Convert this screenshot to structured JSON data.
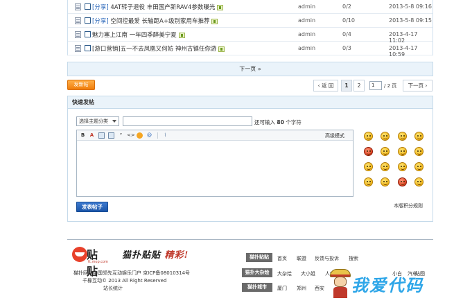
{
  "threads": [
    {
      "tag": "[分享]",
      "title": "4AT转子退役 丰田国产新RAV4参数曝光",
      "author": "admin",
      "replies": "0/2",
      "date": "2013-5-8 09:16"
    },
    {
      "tag": "[分享]",
      "title": "空间控最爱 长轴距A+级别家用车推荐",
      "author": "admin",
      "replies": "0/10",
      "date": "2013-5-8 09:15"
    },
    {
      "tag": "",
      "title": "魅力塞上江南 一年四季醉美宁夏",
      "author": "admin",
      "replies": "0/4",
      "date": "2013-4-17 11:02"
    },
    {
      "tag": "",
      "title": "[游口营销]五一不去凤凰又何妨 神州古镇任你游",
      "author": "admin",
      "replies": "0/3",
      "date": "2013-4-17 10:59"
    }
  ],
  "list": {
    "next_page": "下一页 »"
  },
  "actions": {
    "new_post": "发新帖"
  },
  "pager": {
    "prev": "‹ 返 回",
    "pages": [
      "1",
      "2"
    ],
    "current_input": "1",
    "total": "/ 2 页",
    "next": "下一页 ›"
  },
  "quick_post": {
    "heading": "快速发帖",
    "type_select": "选择主题分类",
    "remain_prefix": "还可输入",
    "remain_count": "80",
    "remain_suffix": "个字符",
    "toolbar": {
      "bold": "B",
      "color": "A",
      "quote": "“",
      "code": "<>",
      "at": "@",
      "attach": "⌇"
    },
    "advanced_mode": "高级模式",
    "submit": "发表帖子",
    "rules": "本版积分规则",
    "smileys": [
      "smile",
      "sad",
      "grin",
      "laugh",
      "angry",
      "shy",
      "wink",
      "kiss",
      "cry",
      "cool",
      "sweat",
      "lol",
      "think",
      "shock",
      "tongue",
      "sleep"
    ]
  },
  "footer": {
    "logo_text": "贴贴",
    "logo_sub": "tt.mop.com",
    "slogan_a": "猫扑贴贴",
    "slogan_b": "精彩!",
    "line1": "猫扑网—中国领先互动娱乐门户 京ICP备08010314号",
    "line2": "千橡互动© 2013 All Right Reserved",
    "line3": "站长统计",
    "groups": [
      {
        "label": "猫扑贴贴",
        "links": [
          "首页",
          "联盟",
          "反馈与投诉",
          "搜索"
        ]
      },
      {
        "label": "猫扑大杂烩",
        "links": [
          "大杂烩",
          "大小姐",
          "人肉搜索",
          "",
          "小白",
          "汽车",
          "贴图"
        ]
      },
      {
        "label": "猫扑城市",
        "links": [
          "厦门",
          "郑州",
          "西安"
        ]
      }
    ],
    "watermark": "我爱代码"
  }
}
